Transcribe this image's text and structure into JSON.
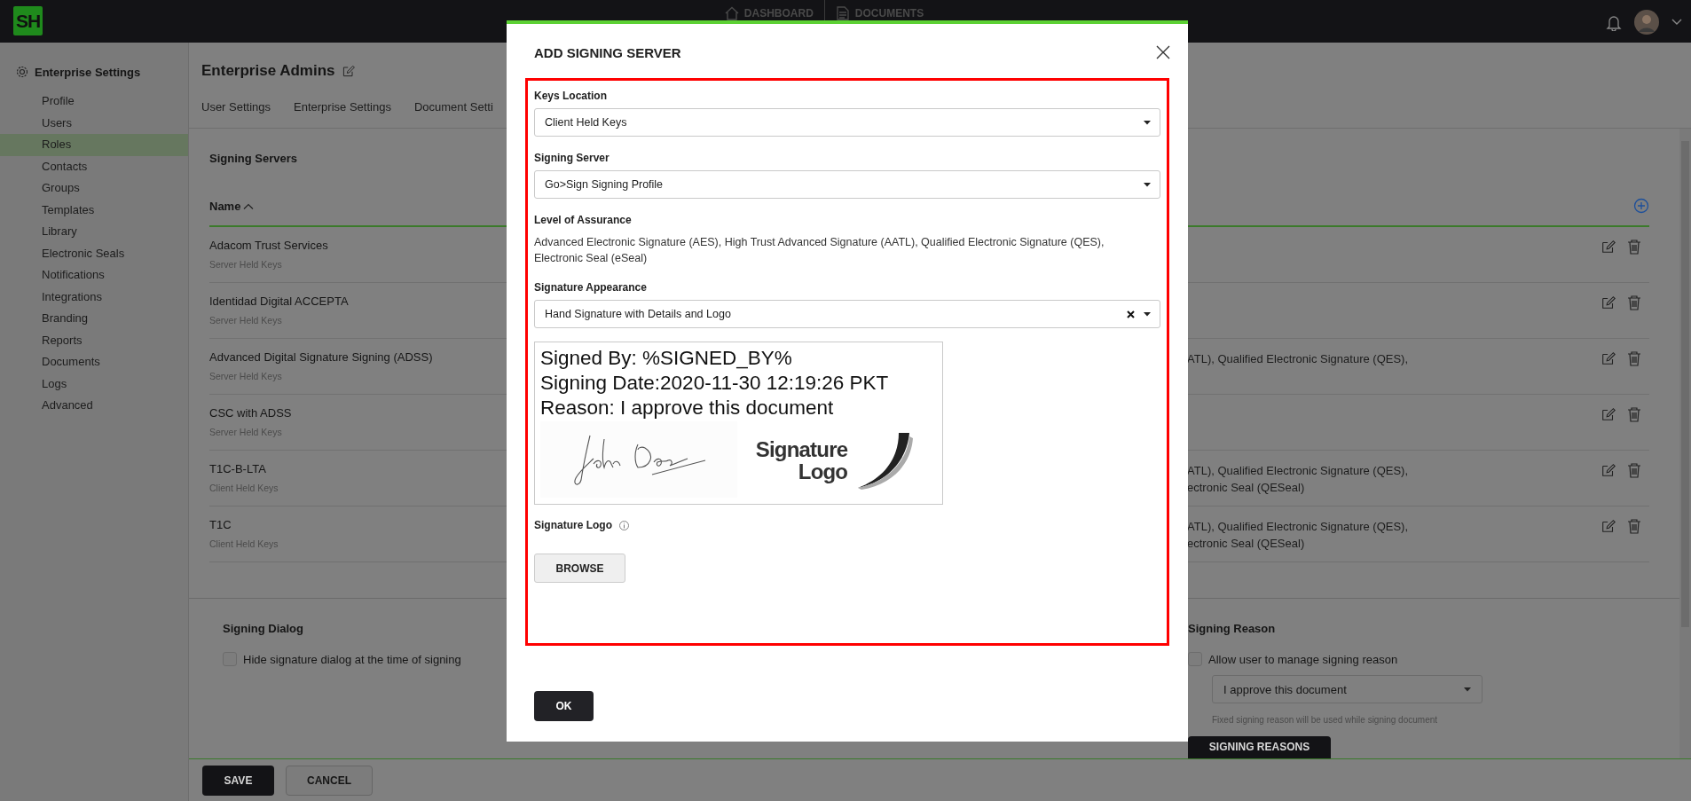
{
  "app": {
    "logo": "SH"
  },
  "top_nav": [
    {
      "label": "DASHBOARD"
    },
    {
      "label": "DOCUMENTS"
    }
  ],
  "sidebar": {
    "title": "Enterprise Settings",
    "items": [
      {
        "label": "Profile",
        "selected": false
      },
      {
        "label": "Users",
        "selected": false
      },
      {
        "label": "Roles",
        "selected": true
      },
      {
        "label": "Contacts",
        "selected": false
      },
      {
        "label": "Groups",
        "selected": false
      },
      {
        "label": "Templates",
        "selected": false
      },
      {
        "label": "Library",
        "selected": false
      },
      {
        "label": "Electronic Seals",
        "selected": false
      },
      {
        "label": "Notifications",
        "selected": false
      },
      {
        "label": "Integrations",
        "selected": false
      },
      {
        "label": "Branding",
        "selected": false
      },
      {
        "label": "Reports",
        "selected": false
      },
      {
        "label": "Documents",
        "selected": false
      },
      {
        "label": "Logs",
        "selected": false
      },
      {
        "label": "Advanced",
        "selected": false
      }
    ]
  },
  "page": {
    "title": "Enterprise Admins",
    "tabs": [
      "User Settings",
      "Enterprise Settings",
      "Document Setti"
    ]
  },
  "signing_servers": {
    "title": "Signing Servers",
    "column_1": "Name",
    "rows": [
      {
        "name": "Adacom Trust Services",
        "keys": "Server Held Keys"
      },
      {
        "name": "Identidad Digital ACCEPTA",
        "keys": "Server Held Keys"
      },
      {
        "name": "Advanced Digital Signature Signing (ADSS)",
        "keys": "Server Held Keys",
        "column_2": [
          "ATL), Qualified Electronic Signature (QES),"
        ]
      },
      {
        "name": "CSC with ADSS",
        "keys": "Server Held Keys"
      },
      {
        "name": "T1C-B-LTA",
        "keys": "Client Held Keys",
        "column_2": [
          "ATL), Qualified Electronic Signature (QES),",
          "ectronic Seal (QESeal)"
        ]
      },
      {
        "name": "T1C",
        "keys": "Client Held Keys",
        "column_2": [
          "ATL), Qualified Electronic Signature (QES),",
          "ectronic Seal (QESeal)"
        ]
      }
    ]
  },
  "signing_dialog": {
    "title": "Signing Dialog",
    "option": {
      "label": "Hide signature dialog at the time of signing",
      "checked": false
    }
  },
  "signing_reason": {
    "title": "Signing Reason",
    "option": {
      "label": "Allow user to manage signing reason",
      "checked": false
    },
    "reason": {
      "value": "I approve this document"
    },
    "hint": "Fixed signing reason will be used while signing document",
    "button": "SIGNING REASONS"
  },
  "footer_buttons": [
    {
      "label": "SAVE",
      "kind": "primary"
    },
    {
      "label": "CANCEL",
      "kind": "secondary"
    }
  ],
  "modal": {
    "title": "ADD SIGNING SERVER",
    "fields": [
      {
        "kind": "select",
        "label": "Keys Location",
        "value": "Client Held Keys"
      },
      {
        "kind": "select",
        "label": "Signing Server",
        "value": "Go>Sign Signing Profile"
      },
      {
        "kind": "text",
        "label": "Level of Assurance",
        "lines": [
          "Advanced Electronic Signature (AES), High Trust Advanced Signature (AATL), Qualified Electronic Signature (QES),",
          "Electronic Seal (eSeal)"
        ]
      },
      {
        "kind": "select",
        "label": "Signature Appearance",
        "value": "Hand Signature with Details and Logo",
        "clearable": true
      },
      {
        "kind": "preview",
        "lines": [
          "Signed By: %SIGNED_BY%",
          "Signing Date:2020-11-30 12:19:26 PKT",
          "Reason: I approve this document"
        ],
        "logo": [
          "Signature",
          "Logo"
        ]
      },
      {
        "kind": "upload",
        "label": "Signature Logo",
        "button": "BROWSE"
      }
    ],
    "button": "OK"
  }
}
